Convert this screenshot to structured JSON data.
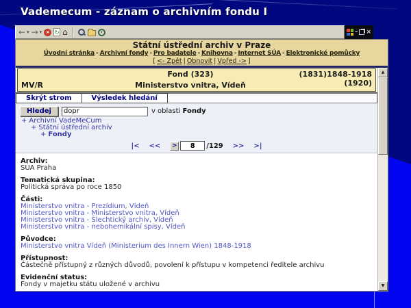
{
  "slide": {
    "title": "Vademecum - záznam o archivním fondu I"
  },
  "icons": {
    "back": "←",
    "forward": "→",
    "caret": "▾",
    "stop": "×",
    "refresh": "↻",
    "home": "⌂",
    "minimize": "–",
    "close": "×",
    "scroll_up": "▲",
    "scroll_down": "▼",
    "tree_expand": "+"
  },
  "page": {
    "header": {
      "title": "Státní ústřední archiv v Praze",
      "nav_links": [
        "Úvodní stránka",
        "Archivní fondy",
        "Pro badatele",
        "Knihovna",
        "Internet SÚA",
        "Elektronické pomůcky"
      ],
      "nav_sep": "-",
      "hist": {
        "open": "[",
        "back": "<- Zpět",
        "sep1": "|",
        "refresh": "Obnovit",
        "sep2": "|",
        "forward": "Vpřed ->",
        "close": "]"
      }
    },
    "fond": {
      "type": "Fond (323)",
      "code": "MV/R",
      "name": "Ministerstvo vnitra, Vídeň",
      "dates1": "(1831)1848-1918",
      "dates2": "(1920)"
    },
    "tabs": {
      "hide_tree": "Skrýt strom",
      "search_results": "Výsledek hledání"
    },
    "search": {
      "button": "Hledej",
      "value": "dopr",
      "in_area": "v oblasti",
      "area": "Fondy"
    },
    "tree": {
      "items": [
        {
          "label": "Archivní VadeMeCum"
        },
        {
          "label": "Státní ústřední archiv"
        },
        {
          "label": "Fondy"
        }
      ]
    },
    "pager": {
      "first": "|<",
      "prev": "<<",
      "go": ">",
      "page": "8",
      "total": "/129",
      "next": ">>",
      "last": ">|"
    },
    "record": {
      "archiv_label": "Archiv:",
      "archiv_value": "SÚA Praha",
      "tema_label": "Tematická skupina:",
      "tema_value": "Politická správa po roce 1850",
      "casti_label": "Části:",
      "casti_links": [
        "Ministerstvo vnitra - Prezídium, Vídeň",
        "Ministerstvo vnitra - Ministerstvo vnitra, Vídeň",
        "Ministerstvo vnitra - Šlechtický archiv, Vídeň",
        "Ministerstvo vnitra - nebohemikální spisy, Vídeň"
      ],
      "puvodce_label": "Původce:",
      "puvodce_link": "Ministerstvo vnitra Vídeň (Ministerium des Innern Wien) 1848-1918",
      "pristupnost_label": "Přístupnost:",
      "pristupnost_value": "Částečně přístupný z různých důvodů, povolení k přístupu v kompetenci ředitele archivu",
      "evidencni_label": "Evidenční status:",
      "evidencni_value": "Fondy v majetku státu uložené v archivu"
    }
  },
  "colors": {
    "slide_blue": "#0205f0",
    "slide_navy": "#01077e",
    "header_tan": "#e7d79f",
    "fond_yellow": "#f7edb4",
    "panel_lavender": "#eef0f7",
    "navy_accent": "#000080",
    "record_link": "#5055c5",
    "tree_link": "#3636a2",
    "toolbar_gray": "#d6d2c6"
  }
}
